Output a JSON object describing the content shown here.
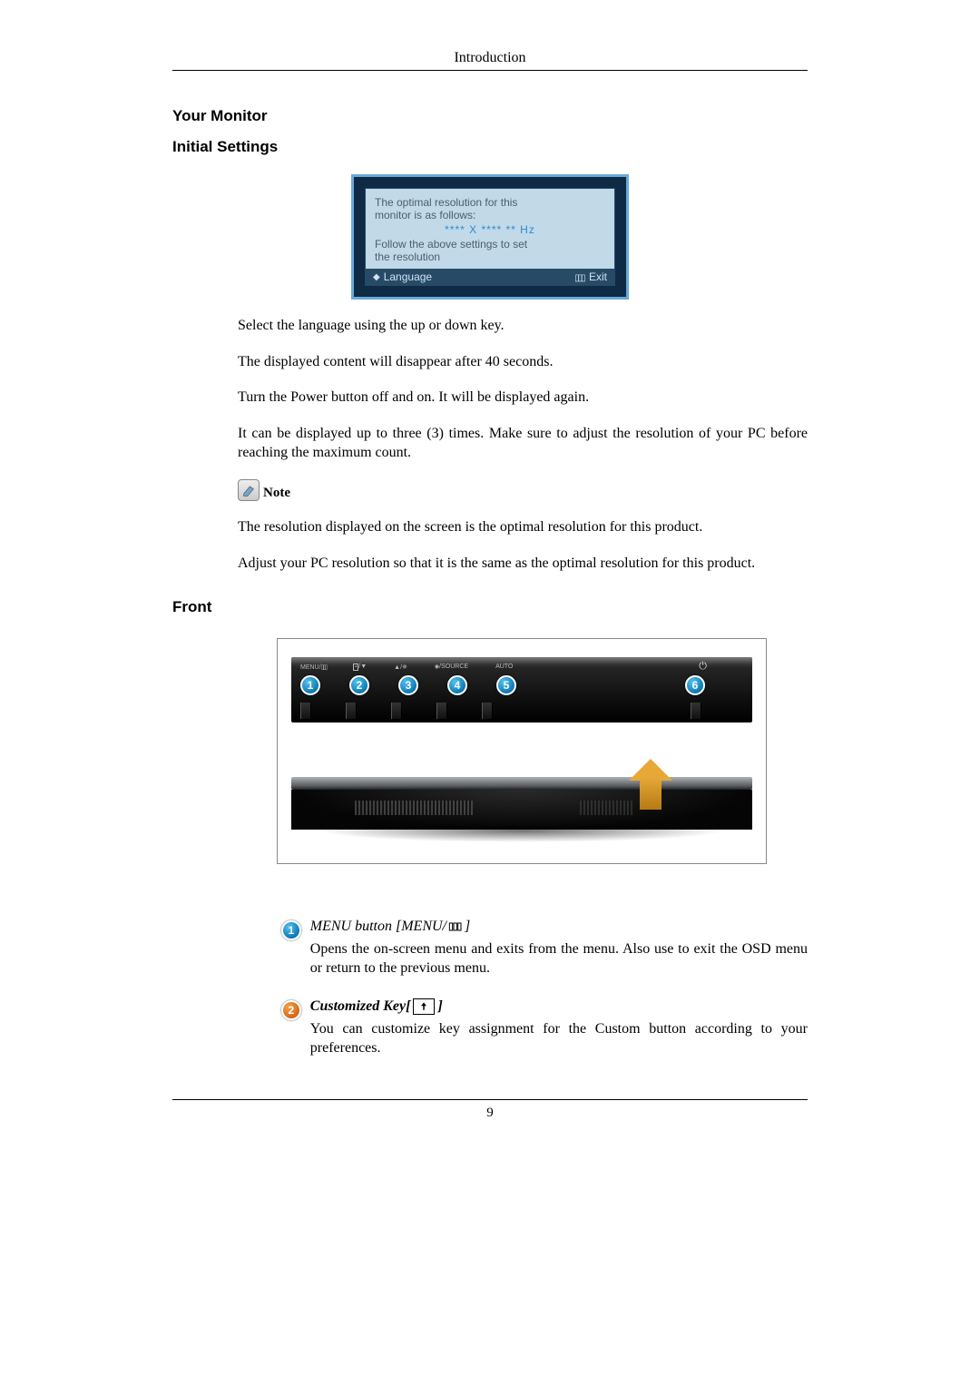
{
  "header": {
    "title": "Introduction"
  },
  "sections": {
    "your_monitor": "Your Monitor",
    "initial_settings": "Initial Settings",
    "front": "Front"
  },
  "osd": {
    "line1": "The optimal resolution for this",
    "line2": "monitor is as follows:",
    "res": "**** X **** ** Hz",
    "line3": "Follow the above settings to set",
    "line4": "the resolution",
    "footer_left": "Language",
    "footer_right": "Exit"
  },
  "paragraphs": {
    "p1": "Select the language using the up or down key.",
    "p2": "The displayed content will disappear after 40 seconds.",
    "p3": "Turn the Power button off and on. It will be displayed again.",
    "p4": "It can be displayed up to three (3) times. Make sure to adjust the resolution of your PC before reaching the maximum count.",
    "note_label": "Note",
    "p5": "The resolution displayed on the screen is the optimal resolution for this product.",
    "p6": "Adjust your PC resolution so that it is the same as the optimal resolution for this product."
  },
  "front_panel": {
    "labels": {
      "b1": "MENU/",
      "b2_down": "▼",
      "b3_up": "▲/",
      "b4": "/SOURCE",
      "b5": "AUTO"
    },
    "numbers": [
      "1",
      "2",
      "3",
      "4",
      "5",
      "6"
    ]
  },
  "descriptions": {
    "item1": {
      "num": "1",
      "title_pre": "MENU button [MENU/",
      "title_post": "]",
      "body": "Opens the on-screen menu and exits from the menu. Also use to exit the OSD menu or return to the previous menu."
    },
    "item2": {
      "num": "2",
      "title_pre": "Customized Key[",
      "title_post": "]",
      "body": "You can customize key assignment for the Custom button according to your preferences."
    }
  },
  "footer": {
    "page_number": "9"
  }
}
